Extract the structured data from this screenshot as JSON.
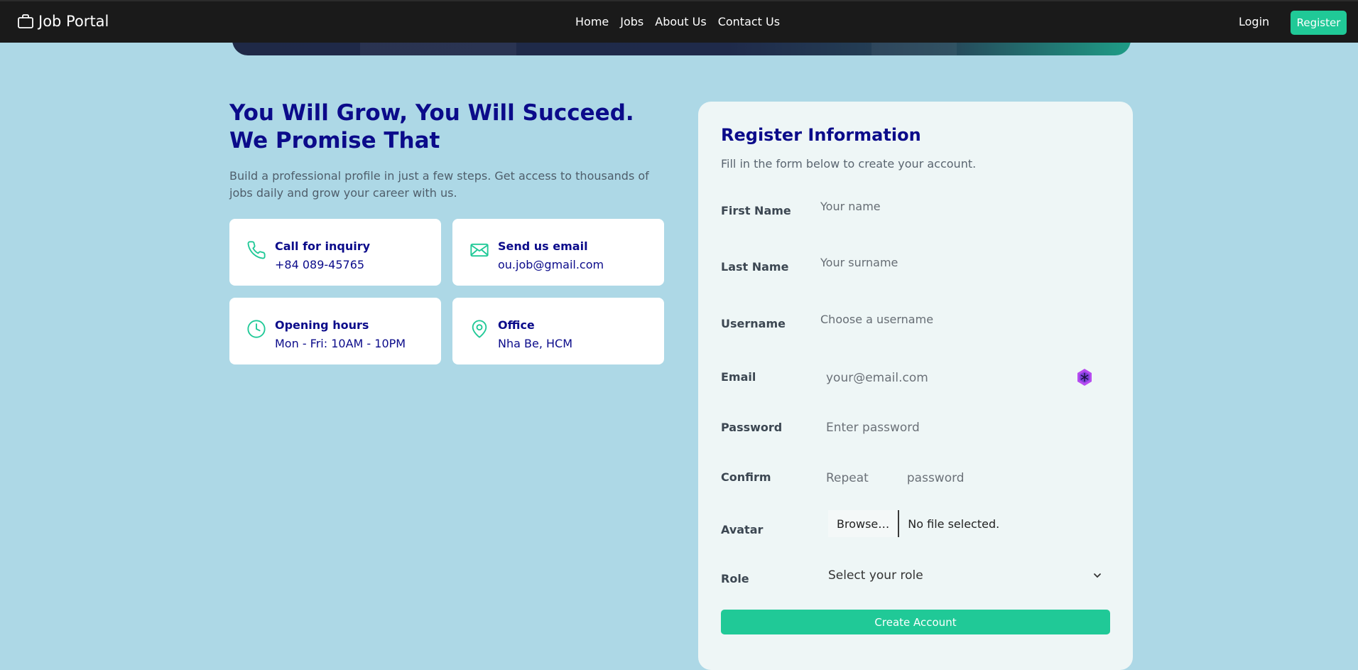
{
  "navbar": {
    "brand": "Job Portal",
    "brand_icon": "briefcase-icon",
    "links": [
      "Home",
      "Jobs",
      "About Us",
      "Contact Us"
    ],
    "login": "Login",
    "register": "Register",
    "accent": "#20c997"
  },
  "hero": {
    "headline": "You Will Grow, You Will Succeed. We Promise That",
    "subtext": "Build a professional profile in just a few steps. Get access to thousands of jobs daily and grow your career with us."
  },
  "contact_cards": [
    {
      "icon": "phone-icon",
      "title": "Call for inquiry",
      "value": "+84 089-45765"
    },
    {
      "icon": "mail-icon",
      "title": "Send us email",
      "value": "ou.job@gmail.com"
    },
    {
      "icon": "clock-icon",
      "title": "Opening hours",
      "value": "Mon - Fri: 10AM - 10PM"
    },
    {
      "icon": "location-pin-icon",
      "title": "Office",
      "value": "Nha Be, HCM"
    }
  ],
  "form": {
    "title": "Register Information",
    "subtitle": "Fill in the form below to create your account.",
    "fields": {
      "first_name": {
        "label": "First Name",
        "placeholder": "Your name"
      },
      "last_name": {
        "label": "Last Name",
        "placeholder": "Your surname"
      },
      "username": {
        "label": "Username",
        "placeholder": "Choose a username"
      },
      "email": {
        "label": "Email",
        "placeholder": "your@email.com"
      },
      "password": {
        "label": "Password",
        "placeholder": "Enter password"
      },
      "confirm": {
        "label": "Confirm",
        "placeholder": "Repeat          password"
      },
      "avatar": {
        "label": "Avatar",
        "button": "Browse…",
        "status": "No file selected."
      },
      "role": {
        "label": "Role",
        "selected": "Select your role"
      }
    },
    "submit": "Create Account"
  },
  "colors": {
    "background": "#add8e6",
    "heading": "#0b0b8a",
    "accent": "#20c997",
    "navbar": "#1a1a1a"
  }
}
